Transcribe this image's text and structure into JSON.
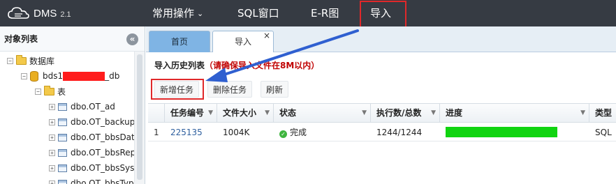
{
  "header": {
    "logo_text": "DMS",
    "version": "2.1",
    "nav": [
      "常用操作",
      "SQL窗口",
      "E-R图",
      "导入"
    ]
  },
  "sidebar": {
    "title": "对象列表",
    "collapse_glyph": "«",
    "tree": {
      "root": "数据库",
      "db_prefix": "bds1",
      "db_suffix": "_db",
      "tables_folder": "表",
      "tables": [
        "dbo.OT_ad",
        "dbo.OT_backup",
        "dbo.OT_bbsDat",
        "dbo.OT_bbsRep",
        "dbo.OT_bbsSys",
        "dbo.OT_bbsTyp"
      ]
    }
  },
  "tabs": [
    {
      "label": "首页"
    },
    {
      "label": "导入",
      "close": "×"
    }
  ],
  "section": {
    "title": "导入历史列表",
    "warning": "（请确保导入文件在8M以内）"
  },
  "toolbar": {
    "add": "新增任务",
    "delete": "删除任务",
    "refresh": "刷新"
  },
  "grid": {
    "columns": [
      "任务编号",
      "文件大小",
      "状态",
      "执行数/总数",
      "进度",
      "类型"
    ],
    "rows": [
      {
        "index": "1",
        "task_id": "225135",
        "size": "1004K",
        "status": "完成",
        "executed": "1244/1244",
        "progress": 1.0,
        "type": "SQL"
      }
    ]
  },
  "colors": {
    "topbar": "#363b43",
    "highlight": "#e0282a",
    "progress": "#10d410",
    "arrow": "#2f5fd0"
  }
}
